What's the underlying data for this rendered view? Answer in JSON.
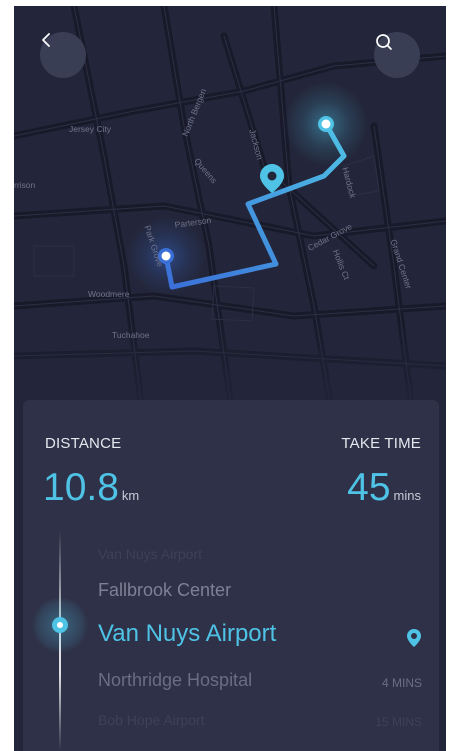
{
  "map": {
    "streets": [
      "Jersey City",
      "North Bergen",
      "Jackson",
      "Queens",
      "Hardock",
      "rrison",
      "Parterson",
      "Cedar Grove",
      "Park Grove",
      "Grand Center",
      "Hollis Ct",
      "Woodmere",
      "Tuchahoe"
    ]
  },
  "icons": {
    "back": "chevron-left-icon",
    "search": "search-icon",
    "location": "location-pin-icon"
  },
  "colors": {
    "accent": "#4fc3e6",
    "route_start": "#3a6fd8",
    "route_end": "#4fc3e6",
    "background": "#23263a",
    "card": "#2e3147"
  },
  "summary": {
    "distance_label": "DISTANCE",
    "distance_value": "10.8",
    "distance_unit": "km",
    "time_label": "TAKE TIME",
    "time_value": "45",
    "time_unit": "mins"
  },
  "stops": [
    {
      "name": "Van Nuys Airport",
      "time": ""
    },
    {
      "name": "Fallbrook Center",
      "time": ""
    },
    {
      "name": "Van Nuys Airport",
      "time": ""
    },
    {
      "name": "Northridge Hospital",
      "time": "4 MINS"
    },
    {
      "name": "Bob Hope Airport",
      "time": "15 MINS"
    }
  ]
}
